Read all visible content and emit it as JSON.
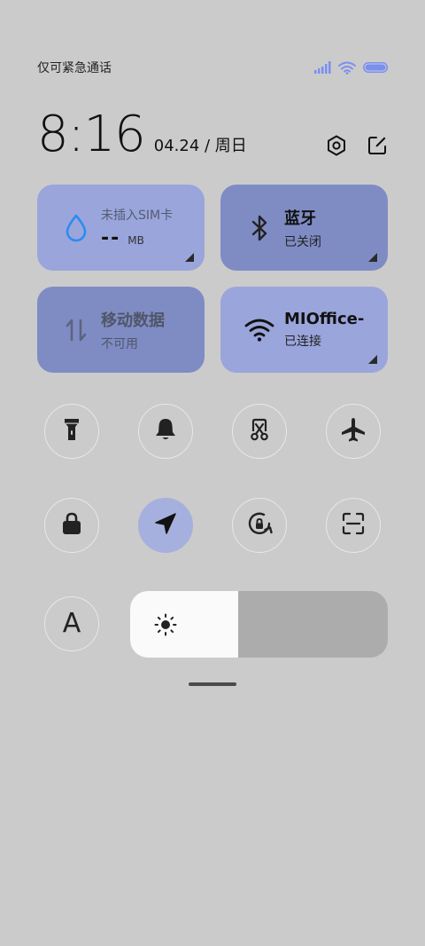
{
  "status": {
    "carrier_text": "仅可紧急通话",
    "icons": [
      "signal-icon",
      "wifi-icon",
      "battery-icon"
    ],
    "accent_color": "#7b8ff0"
  },
  "header": {
    "time": "8:16",
    "date": "04.24 / 周日"
  },
  "tiles": {
    "data_usage": {
      "title": "未插入SIM卡",
      "value": "--",
      "unit": "MB"
    },
    "bluetooth": {
      "title": "蓝牙",
      "subtitle": "已关闭"
    },
    "mobile_data": {
      "title": "移动数据",
      "subtitle": "不可用"
    },
    "wifi": {
      "title": "MIOffice-",
      "subtitle": "已连接"
    }
  },
  "toggles_row1": [
    "flashlight-icon",
    "bell-icon",
    "screenshot-icon",
    "airplane-icon"
  ],
  "toggles_row2": [
    "lock-icon",
    "location-icon",
    "rotation-lock-icon",
    "scan-icon"
  ],
  "active_toggle": "location-icon",
  "font_button": {
    "label": "A"
  },
  "brightness": {
    "level": 0.42
  },
  "colors": {
    "background": "#cbcbcb",
    "tile_light": "#9aa5dc",
    "tile_dark": "#7f8cc4",
    "active_button": "#a6b0de"
  }
}
